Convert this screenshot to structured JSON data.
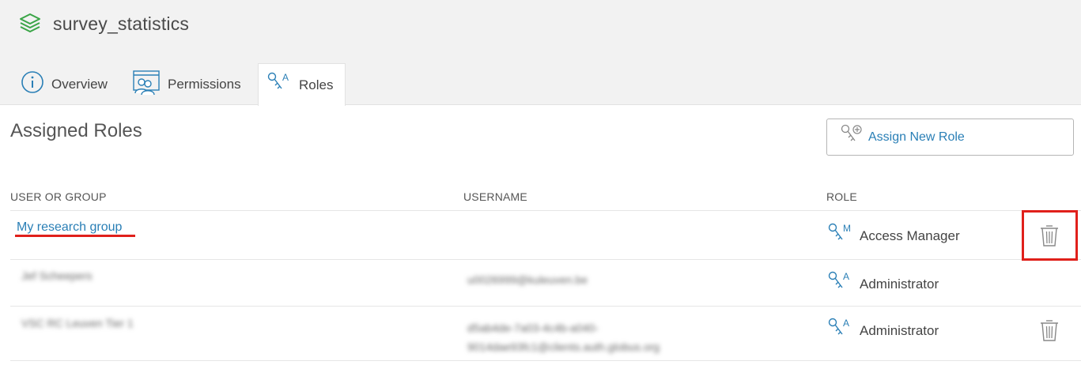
{
  "app": {
    "title": "survey_statistics",
    "icon": "layers-icon",
    "icon_color": "#3aa547"
  },
  "tabs": [
    {
      "label": "Overview",
      "icon": "info-circle-icon",
      "active": false
    },
    {
      "label": "Permissions",
      "icon": "users-window-icon",
      "active": false
    },
    {
      "label": "Roles",
      "icon": "role-key-icon",
      "active": true
    }
  ],
  "page": {
    "heading": "Assigned Roles",
    "assign_button_label": "Assign New Role"
  },
  "table": {
    "columns": [
      "USER OR GROUP",
      "USERNAME",
      "ROLE"
    ],
    "rows": [
      {
        "user": "My research group",
        "username": "",
        "role": "Access Manager",
        "role_letter": "M",
        "is_link": true,
        "deletable": true
      },
      {
        "user": "Jef Scheepers",
        "username": "u0026999@kuleuven.be",
        "role": "Administrator",
        "role_letter": "A",
        "is_link": false,
        "deletable": false
      },
      {
        "user": "VSC RC Leuven Tier 1",
        "username": "d5ab4de-7a03-4c4b-a040-\n9014dae93fc1@clients.auth.globus.org",
        "role": "Administrator",
        "role_letter": "A",
        "is_link": false,
        "deletable": true
      }
    ]
  },
  "colors": {
    "accent": "#2a7fb6",
    "highlight": "#e0201b",
    "tab_bar": "#f2f2f2"
  }
}
